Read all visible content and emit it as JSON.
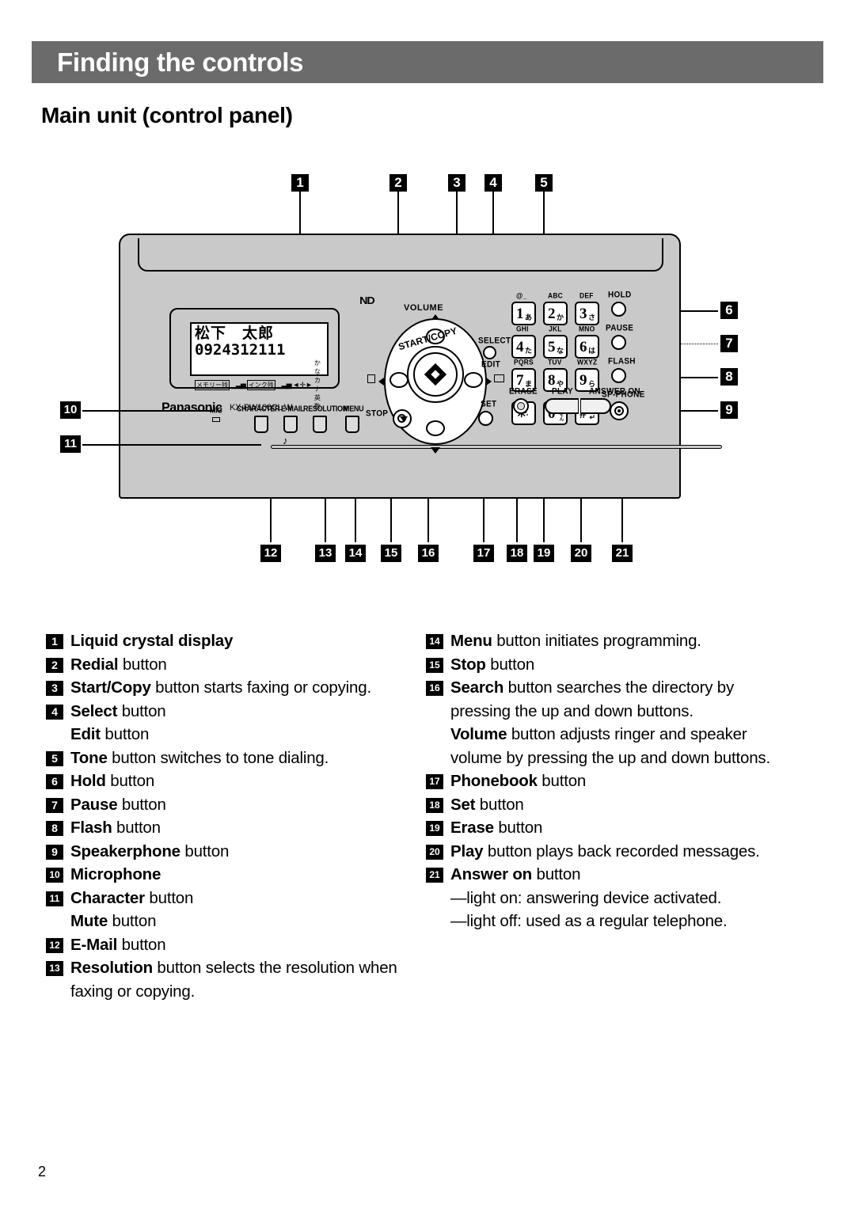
{
  "header": {
    "title": "Finding the controls",
    "bar_color": "#6b6b6b",
    "subtitle": "Main unit (control panel)"
  },
  "page_number": "2",
  "figure": {
    "device_brand": "Panasonic",
    "device_model": "KX-PW100CL W",
    "nd_mark": "ND",
    "lcd": {
      "line1": "松下　太郎",
      "line2": "0924312111",
      "status_memory": "メモリー残",
      "status_ink": "インク残",
      "status_mode": "かなカナ英数",
      "bars": "▁▃▅"
    },
    "nav": {
      "volume_label": "VOLUME",
      "start_copy_label": "START/COPY",
      "select_label": "SELECT",
      "edit_label": "EDIT",
      "set_label": "SET",
      "stop_label": "STOP"
    },
    "function_buttons": [
      {
        "label": "MIC"
      },
      {
        "label": "CHARACTER"
      },
      {
        "label": "E-MAIL"
      },
      {
        "label": "RESOLUTION"
      },
      {
        "label": "MENU"
      }
    ],
    "keypad": [
      {
        "digit": "1",
        "kana": "あ",
        "abc": "@_"
      },
      {
        "digit": "2",
        "kana": "か",
        "abc": "ABC"
      },
      {
        "digit": "3",
        "kana": "さ",
        "abc": "DEF"
      },
      {
        "digit": "4",
        "kana": "た",
        "abc": "GHI"
      },
      {
        "digit": "5",
        "kana": "な",
        "abc": "JKL"
      },
      {
        "digit": "6",
        "kana": "は",
        "abc": "MNO"
      },
      {
        "digit": "7",
        "kana": "ま",
        "abc": "PQRS"
      },
      {
        "digit": "8",
        "kana": "や",
        "abc": "TUV"
      },
      {
        "digit": "9",
        "kana": "ら",
        "abc": "WXYZ"
      },
      {
        "digit": "✳",
        "kana": "゛゜",
        "abc": ""
      },
      {
        "digit": "0",
        "kana": "わをん",
        "abc": ""
      },
      {
        "digit": "#",
        "kana": "↵",
        "abc": ""
      }
    ],
    "side_buttons": [
      {
        "label": "HOLD"
      },
      {
        "label": "PAUSE"
      },
      {
        "label": "FLASH"
      },
      {
        "label": "SP-PHONE"
      }
    ],
    "answering_buttons": [
      {
        "label": "ERASE"
      },
      {
        "label": "PLAY"
      },
      {
        "label": "ANSWER ON"
      }
    ],
    "callouts_top": [
      "1",
      "2",
      "3",
      "4",
      "5"
    ],
    "callouts_right": [
      "6",
      "7",
      "8",
      "9"
    ],
    "callouts_left": [
      "10",
      "11"
    ],
    "callouts_bottom": [
      "12",
      "13",
      "14",
      "15",
      "16",
      "17",
      "18",
      "19",
      "20",
      "21"
    ]
  },
  "legend": {
    "left": [
      {
        "num": "1",
        "bold": "Liquid crystal display",
        "rest": ""
      },
      {
        "num": "2",
        "bold": "Redial",
        "rest": " button"
      },
      {
        "num": "3",
        "bold": "Start/Copy",
        "rest": " button starts faxing or copying."
      },
      {
        "num": "4",
        "bold": "Select",
        "rest": " button"
      },
      {
        "num": "",
        "bold": "Edit",
        "rest": " button",
        "sub": true
      },
      {
        "num": "5",
        "bold": "Tone",
        "rest": " button switches to tone dialing."
      },
      {
        "num": "6",
        "bold": "Hold",
        "rest": " button"
      },
      {
        "num": "7",
        "bold": "Pause",
        "rest": " button"
      },
      {
        "num": "8",
        "bold": "Flash",
        "rest": " button"
      },
      {
        "num": "9",
        "bold": "Speakerphone",
        "rest": " button"
      },
      {
        "num": "10",
        "bold": "Microphone",
        "rest": ""
      },
      {
        "num": "11",
        "bold": "Character",
        "rest": " button"
      },
      {
        "num": "",
        "bold": "Mute",
        "rest": " button",
        "sub": true
      },
      {
        "num": "12",
        "bold": "E-Mail",
        "rest": " button"
      },
      {
        "num": "13",
        "bold": "Resolution",
        "rest": " button selects the resolution when faxing or copying."
      }
    ],
    "right": [
      {
        "num": "14",
        "bold": "Menu",
        "rest": " button initiates programming."
      },
      {
        "num": "15",
        "bold": "Stop",
        "rest": " button"
      },
      {
        "num": "16",
        "bold": "Search",
        "rest": " button searches the directory by pressing the up and down buttons."
      },
      {
        "num": "",
        "bold": "Volume",
        "rest": " button adjusts ringer and speaker volume by pressing the up and down buttons.",
        "sub": true
      },
      {
        "num": "17",
        "bold": "Phonebook",
        "rest": " button"
      },
      {
        "num": "18",
        "bold": "Set",
        "rest": " button"
      },
      {
        "num": "19",
        "bold": "Erase",
        "rest": " button"
      },
      {
        "num": "20",
        "bold": "Play",
        "rest": " button plays back recorded messages."
      },
      {
        "num": "21",
        "bold": "Answer on",
        "rest": " button"
      },
      {
        "num": "",
        "bold": "",
        "rest": "—light on:  answering device activated.",
        "sub": true
      },
      {
        "num": "",
        "bold": "",
        "rest": "—light off:  used as a regular telephone.",
        "sub": true
      }
    ]
  }
}
